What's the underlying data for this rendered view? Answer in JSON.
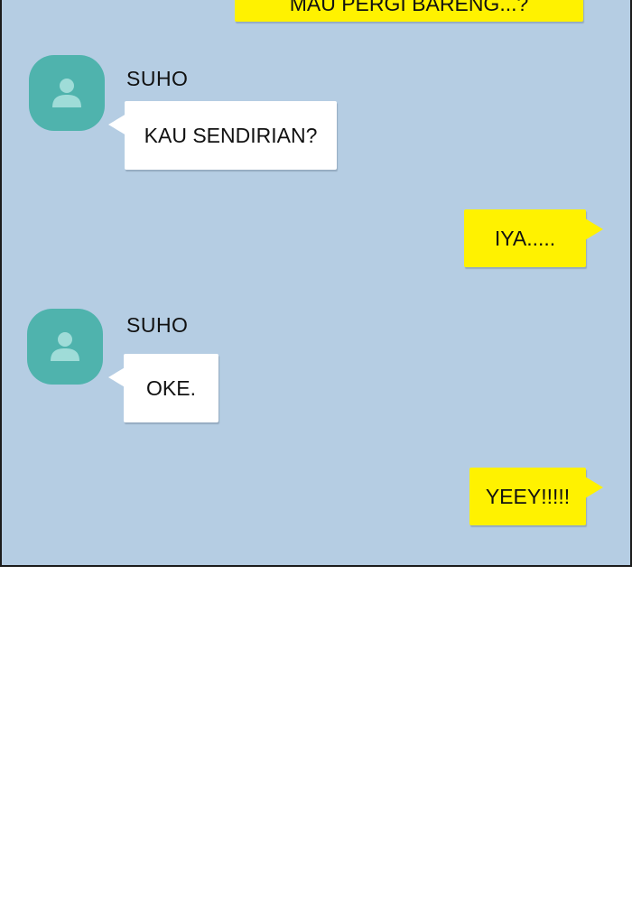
{
  "colors": {
    "chat_background": "#b5cde3",
    "avatar": "#4fb3ad",
    "incoming_bubble": "#ffffff",
    "outgoing_bubble": "#fff200"
  },
  "messages": [
    {
      "direction": "outgoing",
      "text": "MAU PERGI BARENG...?"
    },
    {
      "direction": "incoming",
      "sender": "SUHO",
      "avatar_icon": "person-icon",
      "text": "KAU SENDIRIAN?"
    },
    {
      "direction": "outgoing",
      "text": "IYA....."
    },
    {
      "direction": "incoming",
      "sender": "SUHO",
      "avatar_icon": "person-icon",
      "text": "OKE."
    },
    {
      "direction": "outgoing",
      "text": "YEEY!!!!!"
    }
  ]
}
